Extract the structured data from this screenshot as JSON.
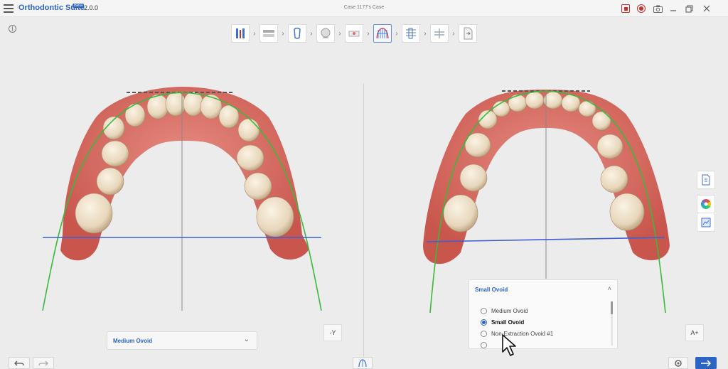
{
  "app": {
    "name": "Orthodontic Suite",
    "badge": "Beta",
    "version": "2.0.0",
    "case_title": "Case 1177's Case"
  },
  "workflow": {
    "active_step": 6,
    "steps": [
      {
        "icon": "tooth-setup-icon"
      },
      {
        "icon": "jaw-scan-icon"
      },
      {
        "icon": "tooth-segment-icon"
      },
      {
        "icon": "face-profile-icon"
      },
      {
        "icon": "model-base-icon"
      },
      {
        "icon": "arch-form-icon"
      },
      {
        "icon": "staging-icon"
      },
      {
        "icon": "attachments-icon"
      },
      {
        "icon": "export-icon"
      }
    ]
  },
  "lower_arch": {
    "arch_form": "Medium Ovoid",
    "view_button": "-Y"
  },
  "upper_arch": {
    "arch_form": "Small Ovoid",
    "view_button": "A+",
    "options": [
      {
        "label": "Medium Ovoid",
        "selected": false
      },
      {
        "label": "Small Ovoid",
        "selected": true
      },
      {
        "label": "Non-Extraction Ovoid #1",
        "selected": false
      }
    ]
  },
  "colors": {
    "accent": "#2b64c2",
    "gingiva": "#d9756b",
    "tooth": "#efe2cc",
    "arch_curve": "#3cb83c",
    "occlusal_line": "#3d5fd1",
    "record": "#c62d2d"
  }
}
